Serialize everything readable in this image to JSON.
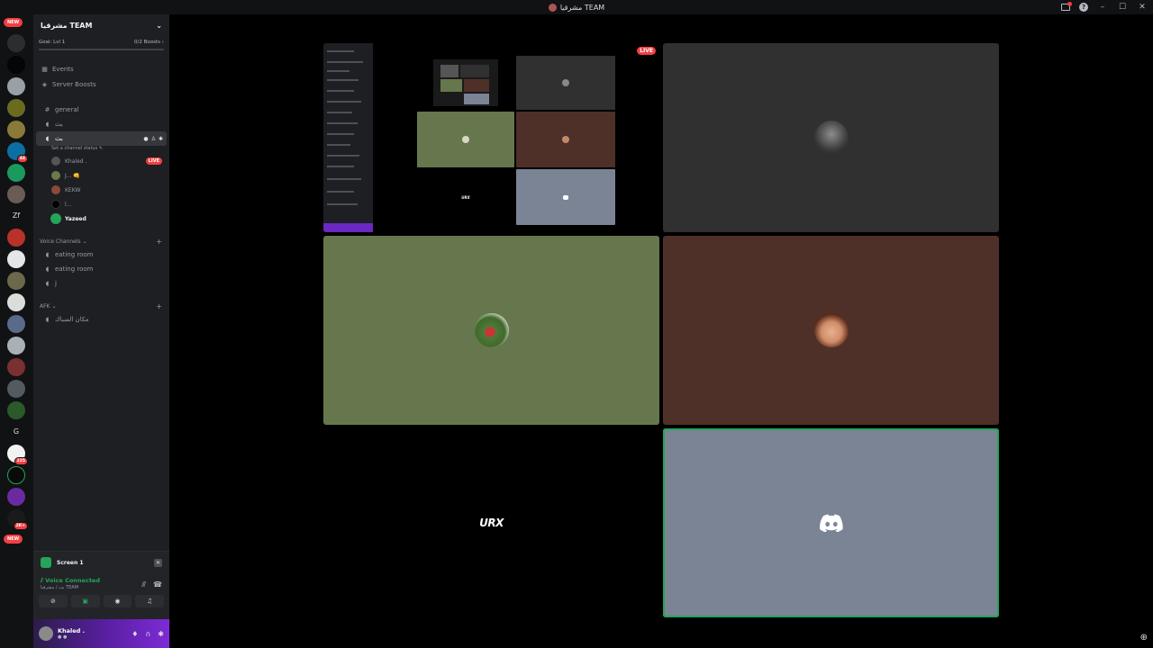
{
  "titlebar": {
    "title": "مشرقيا TEAM",
    "icons": [
      "inbox-icon",
      "help-icon",
      "minimize-icon",
      "maximize-icon",
      "close-icon"
    ]
  },
  "rail": {
    "new_label": "NEW",
    "text_servers": [
      "Zf",
      "G"
    ],
    "badges": [
      "44",
      "225",
      "2K+"
    ]
  },
  "server": {
    "name": "مشرقيا TEAM",
    "goal_label": "Goal: Lvl 1",
    "boosts": "0/2 Boosts"
  },
  "nav": {
    "events": "Events",
    "server_boosts": "Server Boosts"
  },
  "channels": {
    "general": "general",
    "text2": "بث",
    "voice_active": "بث",
    "status_placeholder": "Set a channel status"
  },
  "voice_users": [
    {
      "name": "Khaled .",
      "live": "LIVE"
    },
    {
      "name": "J... 👊"
    },
    {
      "name": "KEKW"
    },
    {
      "name": "l..."
    },
    {
      "name": "Yazeed"
    }
  ],
  "categories": {
    "voice": "Voice Channels",
    "afk": "AFK"
  },
  "voice_channels": [
    "eating room",
    "eating room",
    "j"
  ],
  "afk_channels": [
    "مكان السباك"
  ],
  "screen_panel": {
    "title": "Screen 1"
  },
  "voice_panel": {
    "status": "Voice Connected",
    "sub": "بث / مشرقيا TEAM"
  },
  "user": {
    "name": "Khaled .",
    "sub": "● ●"
  },
  "stage": {
    "live_label": "LIVE",
    "logo_text": "URX",
    "colors": {
      "green_tile": "#66774d",
      "brown_tile": "#4e3029",
      "grey_tile": "#303030",
      "blue_tile": "#7b8495",
      "speaking": "#23a55a"
    }
  }
}
